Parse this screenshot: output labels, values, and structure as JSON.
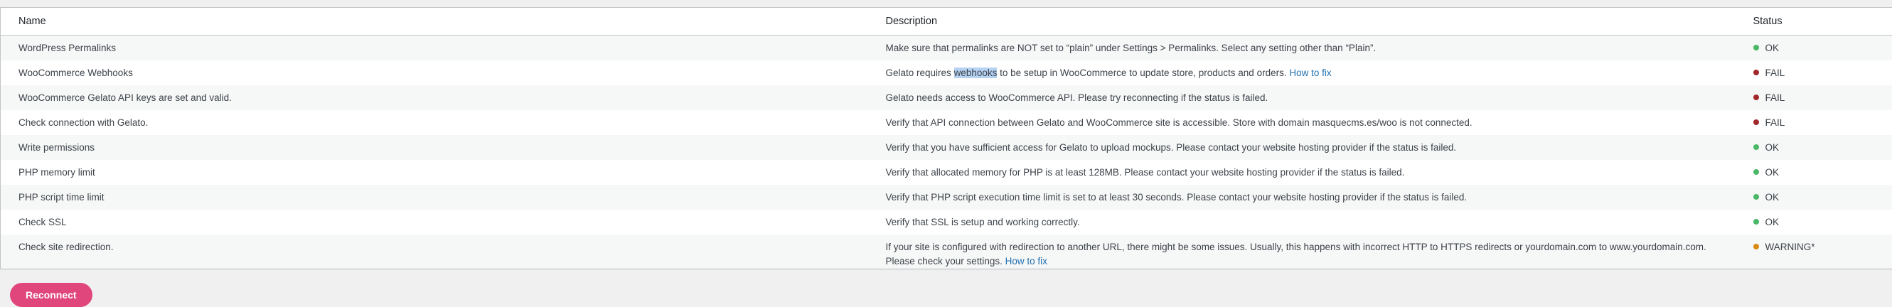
{
  "table": {
    "headers": {
      "name": "Name",
      "description": "Description",
      "status": "Status"
    },
    "rows": [
      {
        "name": "WordPress Permalinks",
        "description": "Make sure that permalinks are NOT set to “plain” under Settings > Permalinks. Select any setting other than “Plain”.",
        "status": "OK",
        "status_type": "ok"
      },
      {
        "name": "WooCommerce Webhooks",
        "description_pre": "Gelato requires ",
        "description_highlight": "webhooks",
        "description_post": " to be setup in WooCommerce to update store, products and orders. ",
        "link": "How to fix",
        "status": "FAIL",
        "status_type": "fail"
      },
      {
        "name": "WooCommerce Gelato API keys are set and valid.",
        "description": "Gelato needs access to WooCommerce API. Please try reconnecting if the status is failed.",
        "status": "FAIL",
        "status_type": "fail"
      },
      {
        "name": "Check connection with Gelato.",
        "description": "Verify that API connection between Gelato and WooCommerce site is accessible. Store with domain masquecms.es/woo is not connected.",
        "status": "FAIL",
        "status_type": "fail"
      },
      {
        "name": "Write permissions",
        "description": "Verify that you have sufficient access for Gelato to upload mockups. Please contact your website hosting provider if the status is failed.",
        "status": "OK",
        "status_type": "ok"
      },
      {
        "name": "PHP memory limit",
        "description": "Verify that allocated memory for PHP is at least 128MB. Please contact your website hosting provider if the status is failed.",
        "status": "OK",
        "status_type": "ok"
      },
      {
        "name": "PHP script time limit",
        "description": "Verify that PHP script execution time limit is set to at least 30 seconds. Please contact your website hosting provider if the status is failed.",
        "status": "OK",
        "status_type": "ok"
      },
      {
        "name": "Check SSL",
        "description": "Verify that SSL is setup and working correctly.",
        "status": "OK",
        "status_type": "ok"
      },
      {
        "name": "Check site redirection.",
        "description_line1": "If your site is configured with redirection to another URL, there might be some issues. Usually, this happens with incorrect HTTP to HTTPS redirects or yourdomain.com to www.yourdomain.com.",
        "description_line2": "Please check your settings. ",
        "link": "How to fix",
        "status": "WARNING*",
        "status_type": "warning"
      }
    ]
  },
  "colors": {
    "ok": "#4ab866",
    "fail": "#a0282b",
    "warning": "#d98a14",
    "link": "#2271b1",
    "button": "#e0457b"
  },
  "footer": {
    "button_label": "Reconnect"
  }
}
